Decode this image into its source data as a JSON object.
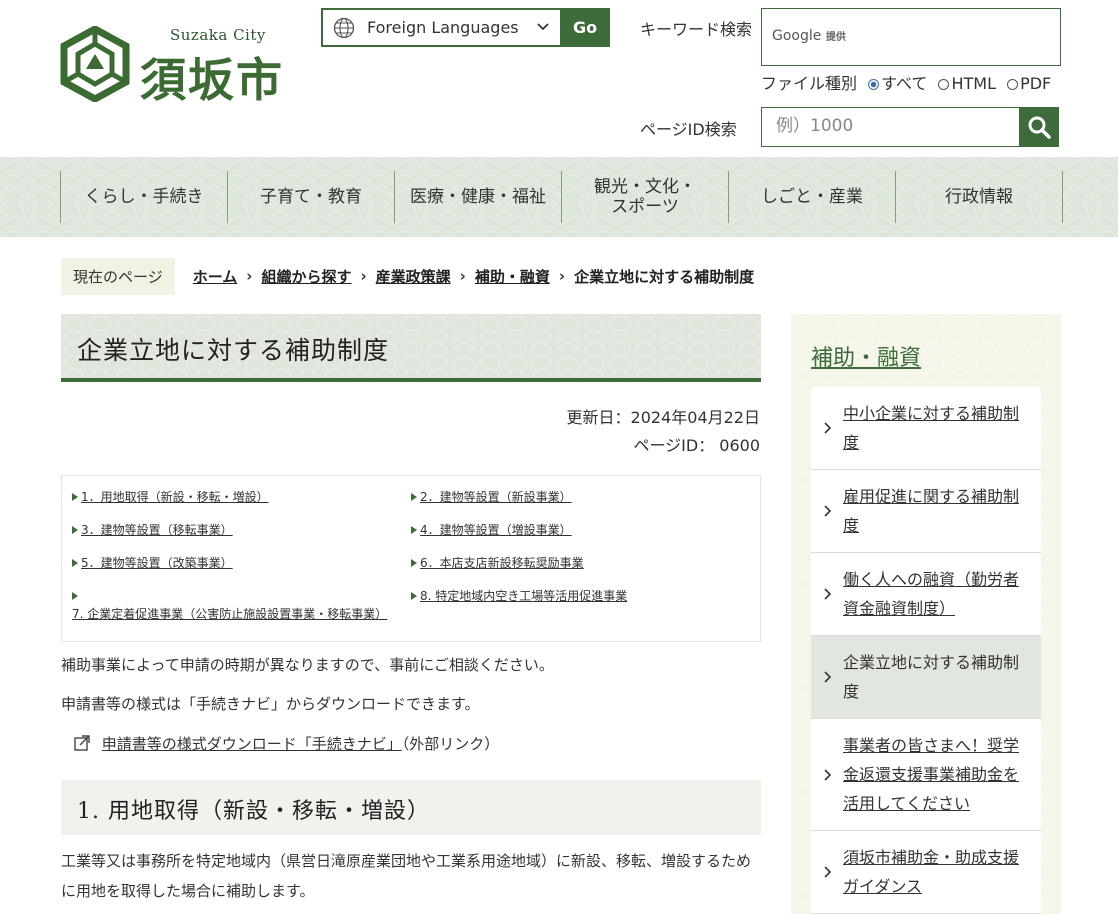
{
  "header": {
    "logo_sub": "Suzaka City",
    "logo_name": "須坂市",
    "lang_select": "Foreign Languages",
    "go_label": "Go",
    "keyword_label": "キーワード検索",
    "google_text": "Google",
    "google_provided": "提供",
    "filetype_label": "ファイル種別",
    "filetype_options": [
      "すべて",
      "HTML",
      "PDF"
    ],
    "pageid_label": "ページID検索",
    "pageid_placeholder": "例）1000"
  },
  "nav": [
    "くらし・手続き",
    "子育て・教育",
    "医療・健康・福祉",
    "観光・文化・スポーツ",
    "しごと・産業",
    "行政情報"
  ],
  "breadcrumb": {
    "current_label": "現在のページ",
    "items": [
      "ホーム",
      "組織から探す",
      "産業政策課",
      "補助・融資"
    ],
    "last": "企業立地に対する補助制度"
  },
  "page": {
    "title": "企業立地に対する補助制度",
    "updated": "更新日：2024年04月22日",
    "page_id": "ページID： 0600"
  },
  "toc": [
    "1．用地取得（新設・移転・増設）",
    "2．建物等設置（新設事業）",
    "3．建物等設置（移転事業）",
    "4．建物等設置（増設事業）",
    "5．建物等設置（改築事業）",
    "6．本店支店新設移転奨励事業",
    "7. 企業定着促進事業（公害防止施設設置事業・移転事業）",
    "8. 特定地域内空き工場等活用促進事業"
  ],
  "body": {
    "p1": "補助事業によって申請の時期が異なりますので、事前にご相談ください。",
    "p2": "申請書等の様式は「手続きナビ」からダウンロードできます。",
    "ext_link": "申請書等の様式ダウンロード「手続きナビ」",
    "ext_suffix": "（外部リンク）",
    "h2": "1.  用地取得（新設・移転・増設）",
    "p3": "工業等又は事務所を特定地域内（県営日滝原産業団地や工業系用途地域）に新設、移転、増設するために用地を取得した場合に補助します。"
  },
  "side": {
    "title": "補助・融資",
    "items": [
      "中小企業に対する補助制度",
      "雇用促進に関する補助制度",
      "働く人への融資（勤労者資金融資制度）",
      "企業立地に対する補助制度",
      "事業者の皆さまへ！奨学金返還支援事業補助金を活用してください",
      "須坂市補助金・助成支援ガイダンス"
    ]
  },
  "colors": {
    "brand_green": "#3d6b3a",
    "nav_bg": "#dde6da",
    "side_current": "#e1e7de"
  }
}
